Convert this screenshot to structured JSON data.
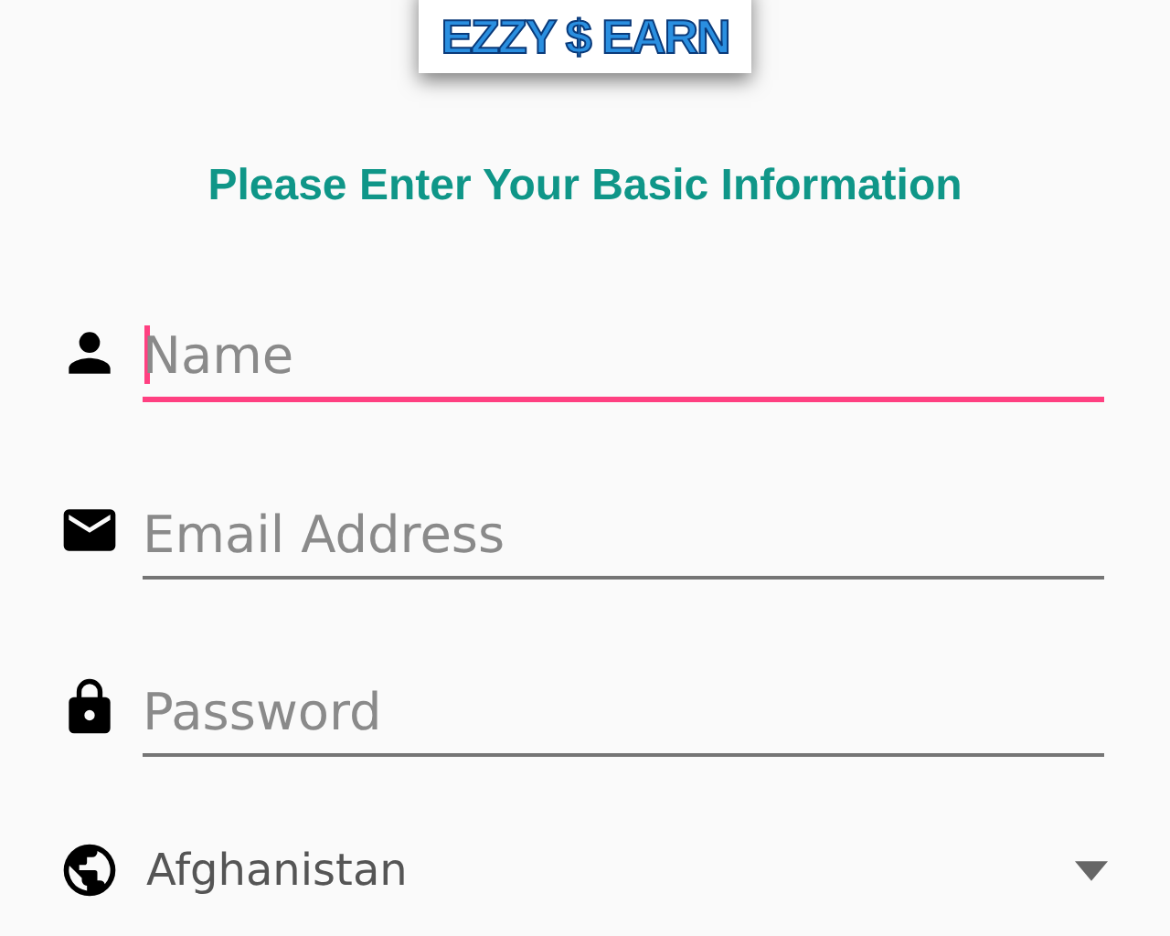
{
  "logo": {
    "text": "EZZY $ EARN"
  },
  "heading": "Please Enter Your Basic Information",
  "fields": [
    {
      "kind": "person",
      "placeholder": "Name",
      "focused": true
    },
    {
      "kind": "mail",
      "placeholder": "Email Address",
      "focused": false
    },
    {
      "kind": "lock",
      "placeholder": "Password",
      "focused": false
    }
  ],
  "country": {
    "value": "Afghanistan"
  }
}
